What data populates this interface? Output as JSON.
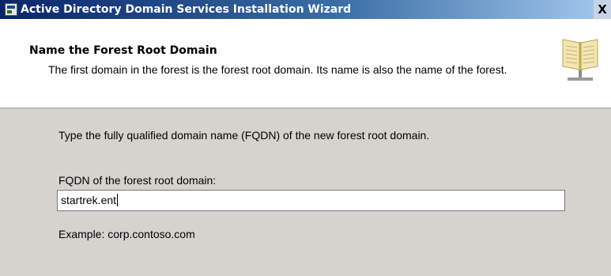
{
  "window": {
    "title": "Active Directory Domain Services Installation Wizard",
    "close_glyph": "X"
  },
  "header": {
    "heading": "Name the Forest Root Domain",
    "subtext": "The first domain in the forest is the forest root domain. Its name is also the name of the forest.",
    "icon": "book-icon"
  },
  "content": {
    "instruction": "Type the fully qualified domain name (FQDN) of the new forest root domain.",
    "fqdn_label": "FQDN of the forest root domain:",
    "fqdn_value": "startrek.ent",
    "example": "Example: corp.contoso.com"
  },
  "colors": {
    "titlebar_start": "#0a246a",
    "titlebar_end": "#a6caf0",
    "header_bg": "#ffffff",
    "body_bg": "#d6d3ce"
  }
}
